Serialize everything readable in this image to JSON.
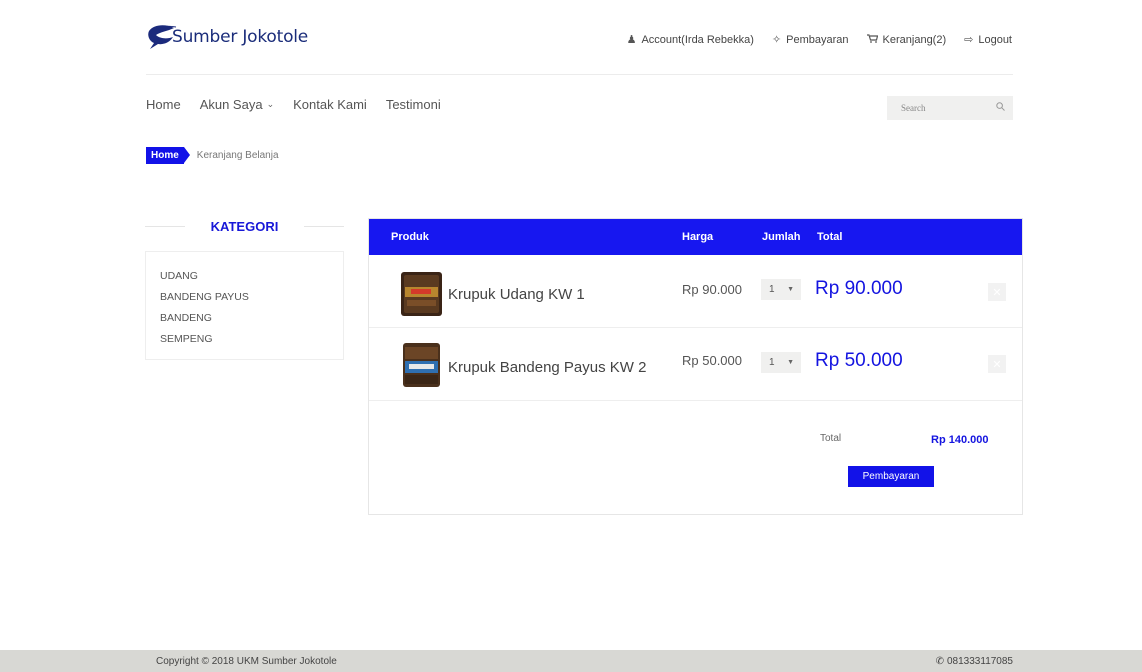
{
  "brand": {
    "name": "Sumber Jokotole",
    "colors": {
      "primary": "#1717f0",
      "accent_text": "#1414e0"
    }
  },
  "top_links": [
    {
      "icon": "user-icon",
      "label": "Account(Irda Rebekka)"
    },
    {
      "icon": "crosshair-icon",
      "label": "Pembayaran"
    },
    {
      "icon": "cart-icon",
      "label": "Keranjang(2)"
    },
    {
      "icon": "logout-icon",
      "label": "Logout"
    }
  ],
  "nav": {
    "items": [
      "Home",
      "Akun Saya",
      "Kontak Kami",
      "Testimoni"
    ],
    "search_placeholder": "Search"
  },
  "breadcrumb": {
    "home": "Home",
    "current": "Keranjang Belanja"
  },
  "sidebar": {
    "title": "KATEGORI",
    "items": [
      "UDANG",
      "BANDENG PAYUS",
      "BANDENG",
      "SEMPENG"
    ]
  },
  "cart": {
    "headers": {
      "product": "Produk",
      "price": "Harga",
      "qty": "Jumlah",
      "total": "Total"
    },
    "rows": [
      {
        "name": "Krupuk Udang KW 1",
        "price": "Rp 90.000",
        "qty": "1",
        "total": "Rp 90.000"
      },
      {
        "name": "Krupuk Bandeng Payus KW 2",
        "price": "Rp 50.000",
        "qty": "1",
        "total": "Rp 50.000"
      }
    ],
    "summary_label": "Total",
    "summary_value": "Rp 140.000",
    "pay_button": "Pembayaran"
  },
  "footer": {
    "copyright": "Copyright © 2018 UKM Sumber Jokotole",
    "phone": "081333117085"
  }
}
